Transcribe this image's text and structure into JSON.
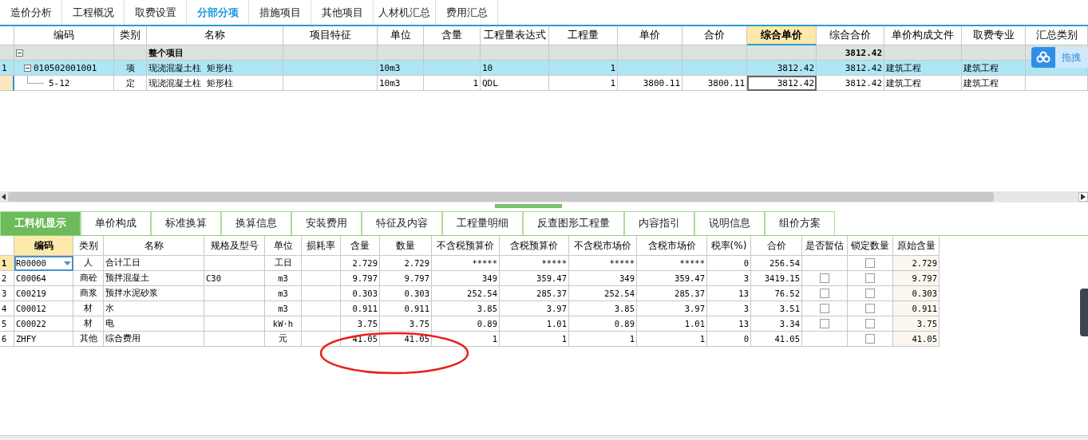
{
  "top_tabs": [
    {
      "label": "造价分析",
      "selected": false
    },
    {
      "label": "工程概况",
      "selected": false
    },
    {
      "label": "取费设置",
      "selected": false
    },
    {
      "label": "分部分项",
      "selected": true
    },
    {
      "label": "措施项目",
      "selected": false
    },
    {
      "label": "其他项目",
      "selected": false
    },
    {
      "label": "人材机汇总",
      "selected": false
    },
    {
      "label": "费用汇总",
      "selected": false
    }
  ],
  "top_table": {
    "columns": [
      {
        "label": "编码",
        "active": false
      },
      {
        "label": "类别",
        "active": false
      },
      {
        "label": "名称",
        "active": false
      },
      {
        "label": "项目特征",
        "active": false
      },
      {
        "label": "单位",
        "active": false
      },
      {
        "label": "含量",
        "active": false
      },
      {
        "label": "工程量表达式",
        "active": false
      },
      {
        "label": "工程量",
        "active": false
      },
      {
        "label": "单价",
        "active": false
      },
      {
        "label": "合价",
        "active": false
      },
      {
        "label": "综合单价",
        "active": true
      },
      {
        "label": "综合合价",
        "active": false
      },
      {
        "label": "单价构成文件",
        "active": false
      },
      {
        "label": "取费专业",
        "active": false
      },
      {
        "label": "汇总类别",
        "active": false
      }
    ],
    "rows": [
      {
        "kind": "group",
        "row_number": "",
        "expanded": true,
        "selected": false,
        "cells": [
          "",
          "",
          "整个项目",
          "",
          "",
          "",
          "",
          "",
          "",
          "",
          "",
          "3812.42",
          "",
          "",
          ""
        ]
      },
      {
        "kind": "item",
        "row_number": "1",
        "expanded": true,
        "selected": true,
        "cells": [
          "010502001001",
          "项",
          "现浇混凝土柱 矩形柱",
          "",
          "10m3",
          "",
          "10",
          "1",
          "",
          "",
          "3812.42",
          "3812.42",
          "建筑工程",
          "建筑工程",
          ""
        ]
      },
      {
        "kind": "quota",
        "row_number": "",
        "selected": false,
        "focused": true,
        "cells": [
          "5-12",
          "定",
          "现浇混凝土柱 矩形柱",
          "",
          "10m3",
          "1",
          "QDL",
          "1",
          "3800.11",
          "3800.11",
          "3812.42",
          "3812.42",
          "建筑工程",
          "建筑工程",
          ""
        ]
      }
    ]
  },
  "drag_widget": {
    "label": "拖拽"
  },
  "bottom_tabs": [
    {
      "label": "工料机显示",
      "selected": true
    },
    {
      "label": "单价构成",
      "selected": false
    },
    {
      "label": "标准换算",
      "selected": false
    },
    {
      "label": "换算信息",
      "selected": false
    },
    {
      "label": "安装费用",
      "selected": false
    },
    {
      "label": "特征及内容",
      "selected": false
    },
    {
      "label": "工程量明细",
      "selected": false
    },
    {
      "label": "反查图形工程量",
      "selected": false
    },
    {
      "label": "内容指引",
      "selected": false
    },
    {
      "label": "说明信息",
      "selected": false
    },
    {
      "label": "组价方案",
      "selected": false
    }
  ],
  "bottom_table": {
    "columns": [
      {
        "label": "编码",
        "active": true
      },
      {
        "label": "类别",
        "active": false
      },
      {
        "label": "名称",
        "active": false
      },
      {
        "label": "规格及型号",
        "active": false
      },
      {
        "label": "单位",
        "active": false
      },
      {
        "label": "损耗率",
        "active": false
      },
      {
        "label": "含量",
        "active": false
      },
      {
        "label": "数量",
        "active": false
      },
      {
        "label": "不含税预算价",
        "active": false
      },
      {
        "label": "含税预算价",
        "active": false
      },
      {
        "label": "不含税市场价",
        "active": false
      },
      {
        "label": "含税市场价",
        "active": false
      },
      {
        "label": "税率(%)",
        "active": false
      },
      {
        "label": "合价",
        "active": false
      },
      {
        "label": "是否暂估",
        "active": false
      },
      {
        "label": "锁定数量",
        "active": false
      },
      {
        "label": "原始含量",
        "active": false
      }
    ],
    "rows": [
      {
        "row_number": "1",
        "selected": true,
        "locked": false,
        "cells": [
          "R00000",
          "人",
          "合计工日",
          "",
          "工日",
          "",
          "2.729",
          "2.729",
          "*****",
          "*****",
          "*****",
          "*****",
          "0",
          "256.54"
        ],
        "original": "2.729"
      },
      {
        "row_number": "2",
        "selected": false,
        "estimated": false,
        "locked": false,
        "cells": [
          "C00064",
          "商砼",
          "预拌混凝土",
          "C30",
          "m3",
          "",
          "9.797",
          "9.797",
          "349",
          "359.47",
          "349",
          "359.47",
          "3",
          "3419.15"
        ],
        "original": "9.797"
      },
      {
        "row_number": "3",
        "selected": false,
        "estimated": false,
        "locked": false,
        "cells": [
          "C00219",
          "商浆",
          "预拌水泥砂浆",
          "",
          "m3",
          "",
          "0.303",
          "0.303",
          "252.54",
          "285.37",
          "252.54",
          "285.37",
          "13",
          "76.52"
        ],
        "original": "0.303"
      },
      {
        "row_number": "4",
        "selected": false,
        "estimated": false,
        "locked": false,
        "cells": [
          "C00012",
          "材",
          "水",
          "",
          "m3",
          "",
          "0.911",
          "0.911",
          "3.85",
          "3.97",
          "3.85",
          "3.97",
          "3",
          "3.51"
        ],
        "original": "0.911"
      },
      {
        "row_number": "5",
        "selected": false,
        "estimated": false,
        "locked": false,
        "cells": [
          "C00022",
          "材",
          "电",
          "",
          "kW·h",
          "",
          "3.75",
          "3.75",
          "0.89",
          "1.01",
          "0.89",
          "1.01",
          "13",
          "3.34"
        ],
        "original": "3.75"
      },
      {
        "row_number": "6",
        "selected": false,
        "locked": false,
        "cells": [
          "ZHFY",
          "其他",
          "综合费用",
          "",
          "元",
          "",
          "41.05",
          "41.05",
          "1",
          "1",
          "1",
          "1",
          "0",
          "41.05"
        ],
        "original": "41.05"
      }
    ]
  }
}
